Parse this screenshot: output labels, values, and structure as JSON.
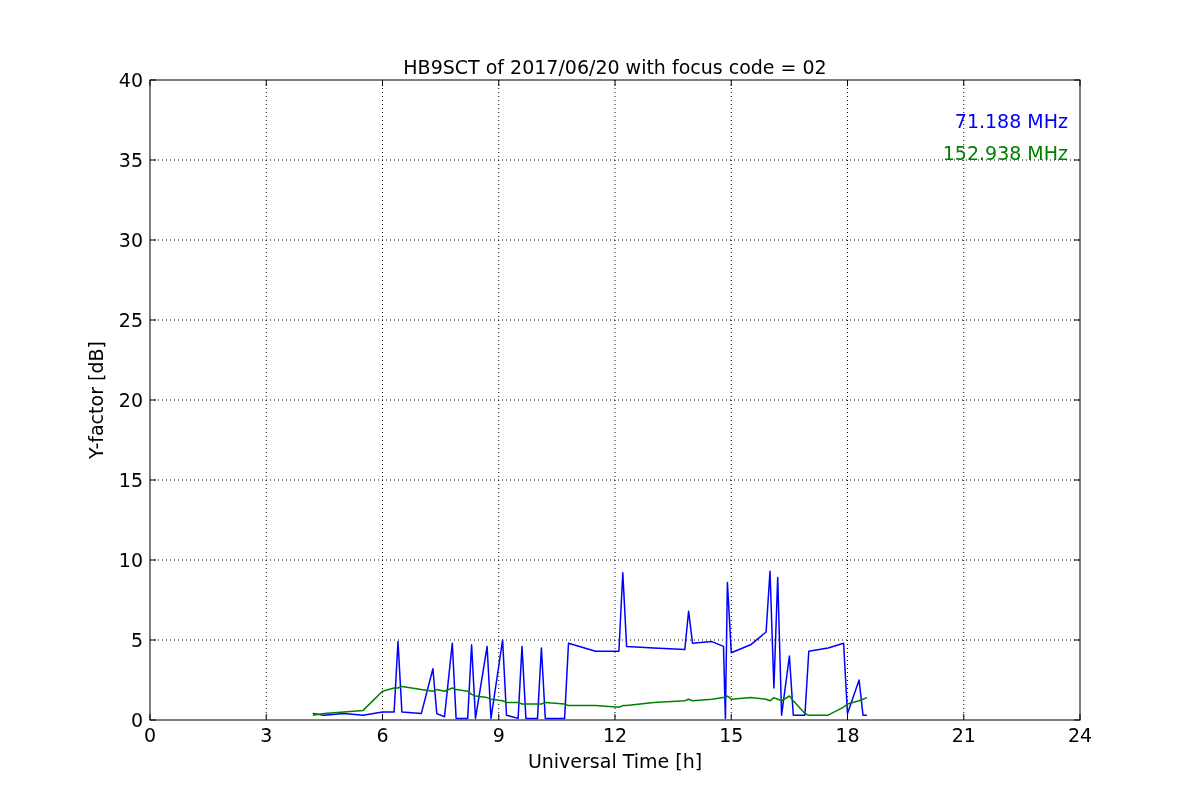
{
  "chart": {
    "chart_data": {
      "type": "line",
      "title": "HB9SCT of 2017/06/20 with focus code = 02",
      "xlabel": "Universal Time [h]",
      "ylabel": "Y-factor [dB]",
      "x": [
        4.2,
        4.5,
        5.0,
        5.5,
        6.0,
        6.3,
        6.4,
        6.5,
        7.0,
        7.3,
        7.4,
        7.6,
        7.8,
        7.9,
        8.2,
        8.3,
        8.4,
        8.7,
        8.8,
        9.1,
        9.2,
        9.5,
        9.6,
        9.7,
        10.0,
        10.1,
        10.2,
        10.7,
        10.8,
        11.5,
        12.1,
        12.2,
        12.3,
        13.0,
        13.8,
        13.9,
        14.0,
        14.5,
        14.8,
        14.85,
        14.9,
        15.0,
        15.5,
        15.9,
        16.0,
        16.1,
        16.2,
        16.3,
        16.5,
        16.6,
        16.9,
        17.0,
        17.5,
        17.9,
        18.0,
        18.3,
        18.4,
        18.5
      ],
      "series": [
        {
          "name": "71.188 MHz",
          "color": "#0000ff",
          "values": [
            0.4,
            0.3,
            0.4,
            0.3,
            0.5,
            0.5,
            4.9,
            0.5,
            0.4,
            3.2,
            0.4,
            0.2,
            4.8,
            0.1,
            0.1,
            4.7,
            0.1,
            4.6,
            0.1,
            5.0,
            0.3,
            0.1,
            4.6,
            0.1,
            0.1,
            4.5,
            0.1,
            0.1,
            4.8,
            4.3,
            4.3,
            9.2,
            4.6,
            4.5,
            4.4,
            6.8,
            4.8,
            4.9,
            4.6,
            0.1,
            8.6,
            4.2,
            4.7,
            5.5,
            9.3,
            2.0,
            8.9,
            0.3,
            4.0,
            0.3,
            0.3,
            4.3,
            4.5,
            4.8,
            0.4,
            2.5,
            0.3,
            0.3
          ]
        },
        {
          "name": "152.938 MHz",
          "color": "#008000",
          "values": [
            0.3,
            0.4,
            0.5,
            0.6,
            1.8,
            2.0,
            2.0,
            2.1,
            1.9,
            1.8,
            1.9,
            1.8,
            2.0,
            1.9,
            1.8,
            1.6,
            1.5,
            1.4,
            1.3,
            1.2,
            1.1,
            1.1,
            1.0,
            1.0,
            1.0,
            1.0,
            1.1,
            1.0,
            0.9,
            0.9,
            0.8,
            0.9,
            0.9,
            1.1,
            1.2,
            1.3,
            1.2,
            1.3,
            1.4,
            1.4,
            1.5,
            1.3,
            1.4,
            1.3,
            1.2,
            1.4,
            1.3,
            1.2,
            1.5,
            1.2,
            0.4,
            0.3,
            0.3,
            0.8,
            1.0,
            1.2,
            1.3,
            1.4
          ]
        }
      ],
      "grid": true,
      "xlim": [
        0,
        24
      ],
      "ylim": [
        0,
        40
      ],
      "xticks": [
        0,
        3,
        6,
        9,
        12,
        15,
        18,
        21,
        24
      ],
      "yticks": [
        0,
        5,
        10,
        15,
        20,
        25,
        30,
        35,
        40
      ]
    }
  }
}
